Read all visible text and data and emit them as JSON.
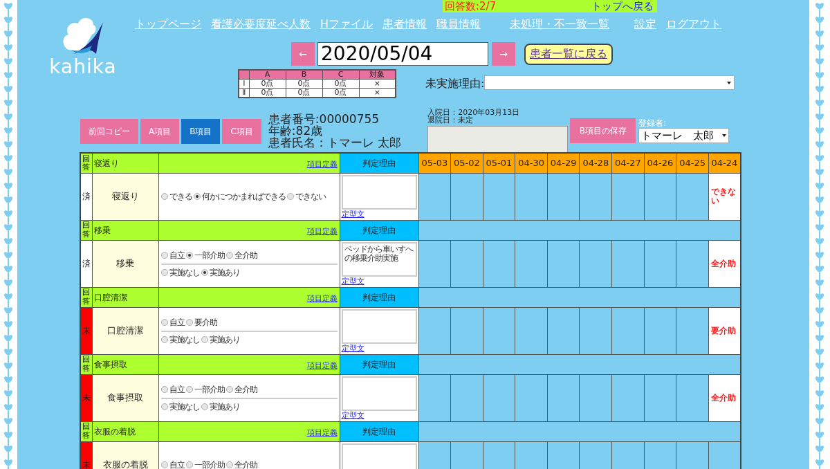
{
  "logo": {
    "text": "kahika"
  },
  "banner": {
    "answer_count": "回答数:2/7",
    "top_link": "トップへ戻る"
  },
  "nav": [
    "トップページ",
    "看護必要度延べ人数",
    "Hファイル",
    "患者情報",
    "職員情報",
    "未処理・不一致一覧",
    "設定",
    "ログアウト"
  ],
  "date_nav": {
    "prev": "←",
    "date": "2020/05/04",
    "next": "→",
    "back": "患者一覧に戻る"
  },
  "score_table": {
    "columns": [
      "A",
      "B",
      "C",
      "対象"
    ],
    "rows": [
      {
        "label": "Ⅰ",
        "cells": [
          "0点",
          "0点",
          "0点",
          "×"
        ]
      },
      {
        "label": "Ⅱ",
        "cells": [
          "0点",
          "0点",
          "0点",
          "×"
        ]
      }
    ]
  },
  "unperformed_reason": {
    "label": "未実施理由:"
  },
  "buttons": [
    {
      "label": "前回コピー",
      "selected": false
    },
    {
      "label": "A項目",
      "selected": false
    },
    {
      "label": "B項目",
      "selected": true
    },
    {
      "label": "C項目",
      "selected": false
    }
  ],
  "patient": {
    "number": "患者番号:00000755",
    "age": "年齢:82歳",
    "name": "患者氏名：トマーレ 太郎"
  },
  "admission": {
    "admitted": "入院日：2020年03月13日",
    "discharged": "退院日：未定"
  },
  "save_button": "B項目の保存",
  "registrant": {
    "label": "登録者:",
    "value": "トマーレ　太郎"
  },
  "table": {
    "dates": [
      "05-03",
      "05-02",
      "05-01",
      "04-30",
      "04-29",
      "04-28",
      "04-27",
      "04-26",
      "04-25",
      "04-24"
    ],
    "sections": [
      {
        "answer_label": "回答",
        "title": "寝返り",
        "definition_link": "項目定義",
        "reason_header": "判定理由",
        "status": "済",
        "answered": true,
        "item": "寝返り",
        "groups": [
          [
            {
              "label": "できる",
              "selected": false
            },
            {
              "label": "何かにつかまればできる",
              "selected": true
            },
            {
              "label": "できない",
              "selected": false
            }
          ]
        ],
        "template_link": "定型文",
        "last_result": "できない"
      },
      {
        "answer_label": "回答",
        "title": "移乗",
        "definition_link": "項目定義",
        "reason_header": "判定理由",
        "status": "済",
        "answered": true,
        "item": "移乗",
        "groups": [
          [
            {
              "label": "自立",
              "selected": false
            },
            {
              "label": "一部介助",
              "selected": true
            },
            {
              "label": "全介助",
              "selected": false
            }
          ],
          [
            {
              "label": "実施なし",
              "selected": false
            },
            {
              "label": "実施あり",
              "selected": true
            }
          ]
        ],
        "reason": "ベッドから車いすへの移乗介助実施",
        "template_link": "定型文",
        "last_result": "全介助"
      },
      {
        "answer_label": "回答",
        "title": "口腔清潔",
        "definition_link": "項目定義",
        "reason_header": "判定理由",
        "status": "未",
        "answered": false,
        "item": "口腔清潔",
        "groups": [
          [
            {
              "label": "自立",
              "selected": false
            },
            {
              "label": "要介助",
              "selected": false
            }
          ],
          [
            {
              "label": "実施なし",
              "selected": false
            },
            {
              "label": "実施あり",
              "selected": false
            }
          ]
        ],
        "template_link": "定型文",
        "last_result": "要介助"
      },
      {
        "answer_label": "回答",
        "title": "食事摂取",
        "definition_link": "項目定義",
        "reason_header": "判定理由",
        "status": "未",
        "answered": false,
        "item": "食事摂取",
        "groups": [
          [
            {
              "label": "自立",
              "selected": false
            },
            {
              "label": "一部介助",
              "selected": false
            },
            {
              "label": "全介助",
              "selected": false
            }
          ],
          [
            {
              "label": "実施なし",
              "selected": false
            },
            {
              "label": "実施あり",
              "selected": false
            }
          ]
        ],
        "template_link": "定型文",
        "last_result": "全介助"
      },
      {
        "answer_label": "回答",
        "title": "衣服の着脱",
        "definition_link": "項目定義",
        "reason_header": "判定理由",
        "status": "未",
        "answered": false,
        "item": "衣服の着脱",
        "groups": [
          [
            {
              "label": "自立",
              "selected": false
            },
            {
              "label": "一部介助",
              "selected": false
            },
            {
              "label": "全介助",
              "selected": false
            }
          ]
        ]
      }
    ]
  }
}
